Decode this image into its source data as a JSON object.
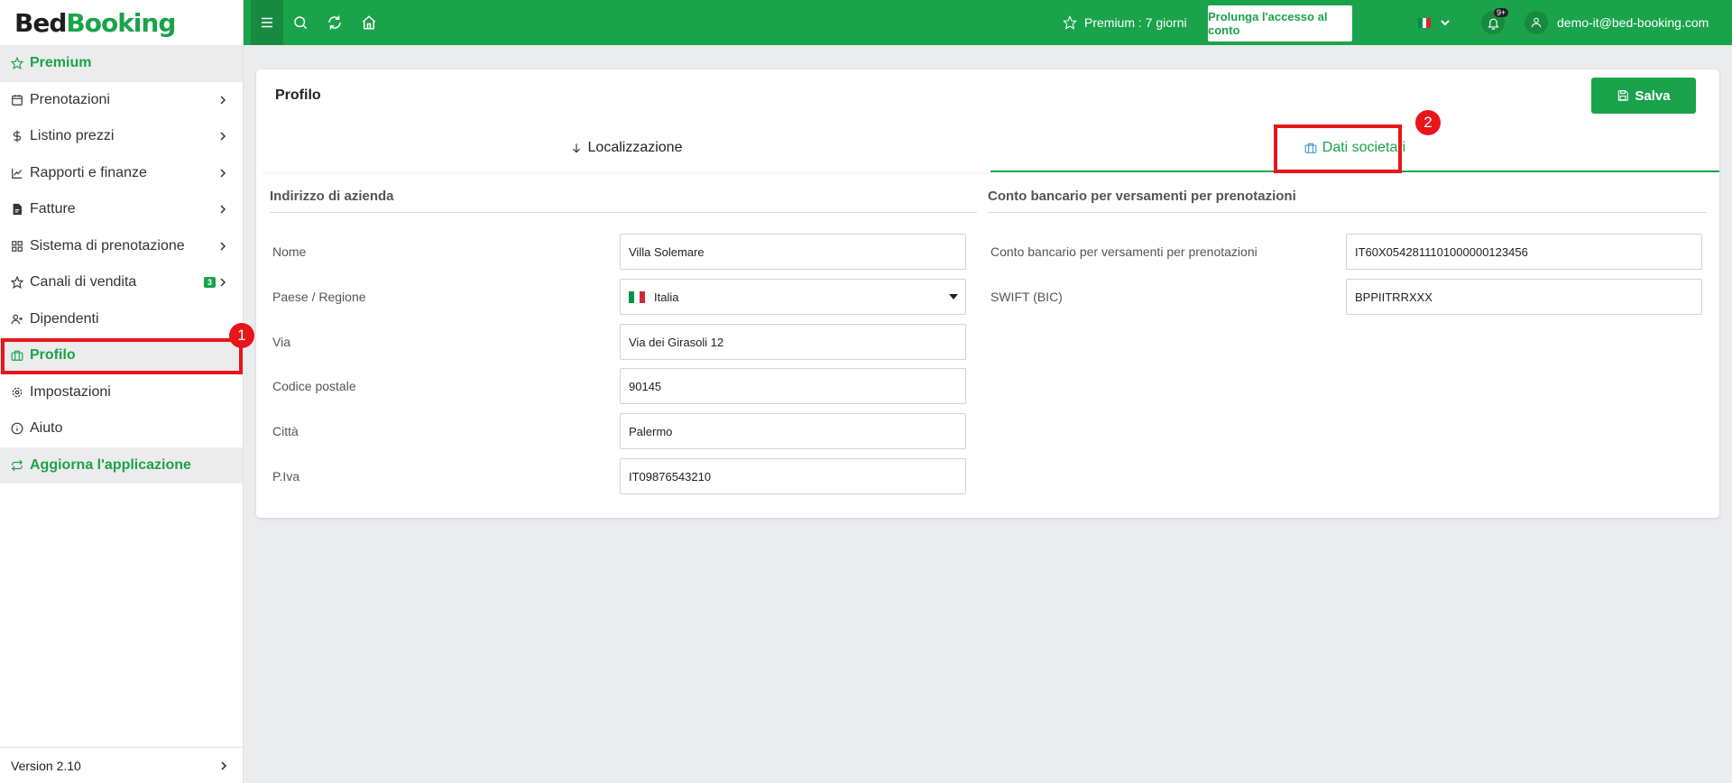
{
  "logo": {
    "part1": "Bed",
    "part2": "Booking"
  },
  "sidebar": {
    "items": [
      {
        "label": "Premium",
        "icon": "star-icon"
      },
      {
        "label": "Prenotazioni",
        "icon": "calendar-icon"
      },
      {
        "label": "Listino prezzi",
        "icon": "dollar-icon"
      },
      {
        "label": "Rapporti e finanze",
        "icon": "chart-icon"
      },
      {
        "label": "Fatture",
        "icon": "invoice-icon"
      },
      {
        "label": "Sistema di prenotazione",
        "icon": "grid-icon"
      },
      {
        "label": "Canali di vendita",
        "icon": "star-icon",
        "badge": "3"
      },
      {
        "label": "Dipendenti",
        "icon": "user-plus-icon"
      },
      {
        "label": "Profilo",
        "icon": "briefcase-icon"
      },
      {
        "label": "Impostazioni",
        "icon": "gear-icon"
      },
      {
        "label": "Aiuto",
        "icon": "info-icon"
      },
      {
        "label": "Aggiorna l'applicazione",
        "icon": "refresh-icon"
      }
    ],
    "version": "Version 2.10"
  },
  "annotations": {
    "first": "1",
    "second": "2"
  },
  "header": {
    "premium_text": "Premium : 7 giorni",
    "extend_label": "Prolunga l'accesso al conto",
    "notifications_count": "9+",
    "user_email": "demo-it@bed-booking.com",
    "colors": {
      "brand": "#1aa34a",
      "brand_dark": "#168b3f",
      "annotation": "#e8161b"
    }
  },
  "card": {
    "title": "Profilo",
    "save_label": "Salva",
    "tabs": [
      {
        "label": "Localizzazione",
        "icon": "arrow-down-icon"
      },
      {
        "label": "Dati societari",
        "icon": "briefcase-icon",
        "active": true
      }
    ]
  },
  "company": {
    "title": "Indirizzo di azienda",
    "fields": [
      {
        "label": "Nome",
        "value": "Villa Solemare"
      },
      {
        "label": "Paese / Regione",
        "value": "Italia"
      },
      {
        "label": "Via",
        "value": "Via dei Girasoli 12"
      },
      {
        "label": "Codice postale",
        "value": "90145"
      },
      {
        "label": "Città",
        "value": "Palermo"
      },
      {
        "label": "P.Iva",
        "value": "IT09876543210"
      }
    ]
  },
  "bank": {
    "title": "Conto bancario per versamenti per prenotazioni",
    "fields": [
      {
        "label": "Conto bancario per versamenti per prenotazioni",
        "value": "IT60X0542811101000000123456"
      },
      {
        "label": "SWIFT (BIC)",
        "value": "BPPIITRRXXX"
      }
    ]
  }
}
